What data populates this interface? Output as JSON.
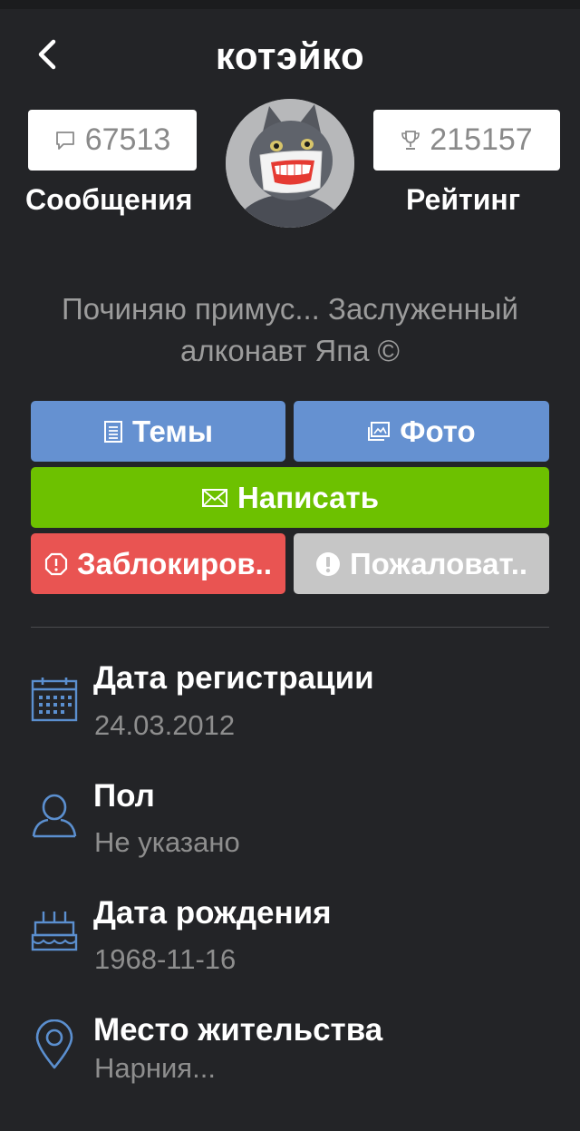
{
  "header": {
    "title": "котэйко",
    "back_icon": "chevron-left-icon"
  },
  "stats": {
    "messages": {
      "icon": "speech-bubble-icon",
      "value": "67513",
      "label": "Сообщения"
    },
    "rating": {
      "icon": "trophy-icon",
      "value": "215157",
      "label": "Рейтинг"
    }
  },
  "profile": {
    "bio": "Починяю примус... Заслуженный алконавт Япа ©"
  },
  "actions": {
    "topics": {
      "icon": "document-icon",
      "label": "Темы",
      "color": "#6591d1"
    },
    "photo": {
      "icon": "image-icon",
      "label": "Фото",
      "color": "#6591d1"
    },
    "write": {
      "icon": "envelope-icon",
      "label": "Написать",
      "color": "#6dc100"
    },
    "block": {
      "icon": "octagon-alert-icon",
      "label": "Заблокиров..",
      "color": "#e95452"
    },
    "report": {
      "icon": "exclamation-circle-icon",
      "label": "Пожаловат..",
      "color": "#c6c6c6"
    }
  },
  "info": [
    {
      "icon": "calendar-icon",
      "title": "Дата регистрации",
      "value": "24.03.2012"
    },
    {
      "icon": "user-icon",
      "title": "Пол",
      "value": "Не указано"
    },
    {
      "icon": "birthday-cake-icon",
      "title": "Дата рождения",
      "value": "1968-11-16"
    },
    {
      "icon": "location-pin-icon",
      "title": "Место жительства",
      "value": "Нарния..."
    }
  ],
  "colors": {
    "background": "#232427",
    "icon_accent": "#5b8fcf"
  }
}
